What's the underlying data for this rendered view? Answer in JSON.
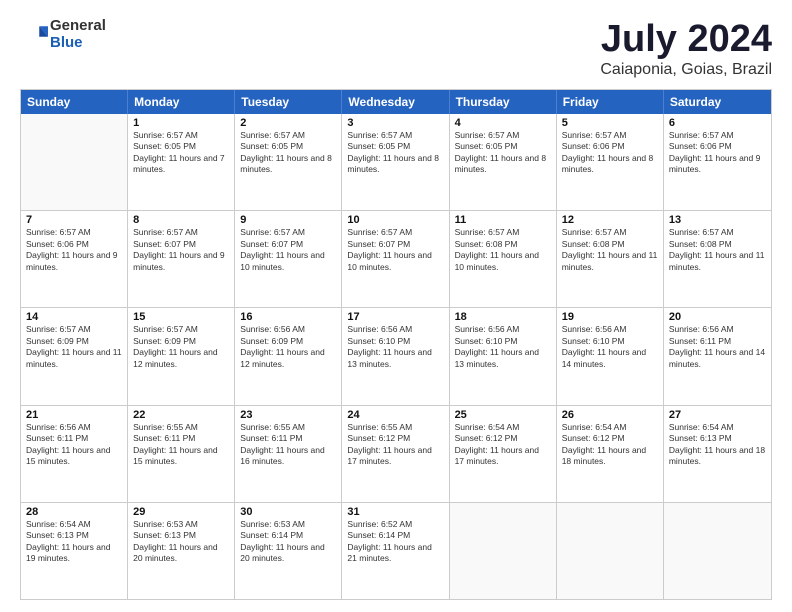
{
  "logo": {
    "general": "General",
    "blue": "Blue"
  },
  "title": "July 2024",
  "subtitle": "Caiaponia, Goias, Brazil",
  "header_days": [
    "Sunday",
    "Monday",
    "Tuesday",
    "Wednesday",
    "Thursday",
    "Friday",
    "Saturday"
  ],
  "weeks": [
    [
      {
        "day": "",
        "sunrise": "",
        "sunset": "",
        "daylight": ""
      },
      {
        "day": "1",
        "sunrise": "Sunrise: 6:57 AM",
        "sunset": "Sunset: 6:05 PM",
        "daylight": "Daylight: 11 hours and 7 minutes."
      },
      {
        "day": "2",
        "sunrise": "Sunrise: 6:57 AM",
        "sunset": "Sunset: 6:05 PM",
        "daylight": "Daylight: 11 hours and 8 minutes."
      },
      {
        "day": "3",
        "sunrise": "Sunrise: 6:57 AM",
        "sunset": "Sunset: 6:05 PM",
        "daylight": "Daylight: 11 hours and 8 minutes."
      },
      {
        "day": "4",
        "sunrise": "Sunrise: 6:57 AM",
        "sunset": "Sunset: 6:05 PM",
        "daylight": "Daylight: 11 hours and 8 minutes."
      },
      {
        "day": "5",
        "sunrise": "Sunrise: 6:57 AM",
        "sunset": "Sunset: 6:06 PM",
        "daylight": "Daylight: 11 hours and 8 minutes."
      },
      {
        "day": "6",
        "sunrise": "Sunrise: 6:57 AM",
        "sunset": "Sunset: 6:06 PM",
        "daylight": "Daylight: 11 hours and 9 minutes."
      }
    ],
    [
      {
        "day": "7",
        "sunrise": "Sunrise: 6:57 AM",
        "sunset": "Sunset: 6:06 PM",
        "daylight": "Daylight: 11 hours and 9 minutes."
      },
      {
        "day": "8",
        "sunrise": "Sunrise: 6:57 AM",
        "sunset": "Sunset: 6:07 PM",
        "daylight": "Daylight: 11 hours and 9 minutes."
      },
      {
        "day": "9",
        "sunrise": "Sunrise: 6:57 AM",
        "sunset": "Sunset: 6:07 PM",
        "daylight": "Daylight: 11 hours and 10 minutes."
      },
      {
        "day": "10",
        "sunrise": "Sunrise: 6:57 AM",
        "sunset": "Sunset: 6:07 PM",
        "daylight": "Daylight: 11 hours and 10 minutes."
      },
      {
        "day": "11",
        "sunrise": "Sunrise: 6:57 AM",
        "sunset": "Sunset: 6:08 PM",
        "daylight": "Daylight: 11 hours and 10 minutes."
      },
      {
        "day": "12",
        "sunrise": "Sunrise: 6:57 AM",
        "sunset": "Sunset: 6:08 PM",
        "daylight": "Daylight: 11 hours and 11 minutes."
      },
      {
        "day": "13",
        "sunrise": "Sunrise: 6:57 AM",
        "sunset": "Sunset: 6:08 PM",
        "daylight": "Daylight: 11 hours and 11 minutes."
      }
    ],
    [
      {
        "day": "14",
        "sunrise": "Sunrise: 6:57 AM",
        "sunset": "Sunset: 6:09 PM",
        "daylight": "Daylight: 11 hours and 11 minutes."
      },
      {
        "day": "15",
        "sunrise": "Sunrise: 6:57 AM",
        "sunset": "Sunset: 6:09 PM",
        "daylight": "Daylight: 11 hours and 12 minutes."
      },
      {
        "day": "16",
        "sunrise": "Sunrise: 6:56 AM",
        "sunset": "Sunset: 6:09 PM",
        "daylight": "Daylight: 11 hours and 12 minutes."
      },
      {
        "day": "17",
        "sunrise": "Sunrise: 6:56 AM",
        "sunset": "Sunset: 6:10 PM",
        "daylight": "Daylight: 11 hours and 13 minutes."
      },
      {
        "day": "18",
        "sunrise": "Sunrise: 6:56 AM",
        "sunset": "Sunset: 6:10 PM",
        "daylight": "Daylight: 11 hours and 13 minutes."
      },
      {
        "day": "19",
        "sunrise": "Sunrise: 6:56 AM",
        "sunset": "Sunset: 6:10 PM",
        "daylight": "Daylight: 11 hours and 14 minutes."
      },
      {
        "day": "20",
        "sunrise": "Sunrise: 6:56 AM",
        "sunset": "Sunset: 6:11 PM",
        "daylight": "Daylight: 11 hours and 14 minutes."
      }
    ],
    [
      {
        "day": "21",
        "sunrise": "Sunrise: 6:56 AM",
        "sunset": "Sunset: 6:11 PM",
        "daylight": "Daylight: 11 hours and 15 minutes."
      },
      {
        "day": "22",
        "sunrise": "Sunrise: 6:55 AM",
        "sunset": "Sunset: 6:11 PM",
        "daylight": "Daylight: 11 hours and 15 minutes."
      },
      {
        "day": "23",
        "sunrise": "Sunrise: 6:55 AM",
        "sunset": "Sunset: 6:11 PM",
        "daylight": "Daylight: 11 hours and 16 minutes."
      },
      {
        "day": "24",
        "sunrise": "Sunrise: 6:55 AM",
        "sunset": "Sunset: 6:12 PM",
        "daylight": "Daylight: 11 hours and 17 minutes."
      },
      {
        "day": "25",
        "sunrise": "Sunrise: 6:54 AM",
        "sunset": "Sunset: 6:12 PM",
        "daylight": "Daylight: 11 hours and 17 minutes."
      },
      {
        "day": "26",
        "sunrise": "Sunrise: 6:54 AM",
        "sunset": "Sunset: 6:12 PM",
        "daylight": "Daylight: 11 hours and 18 minutes."
      },
      {
        "day": "27",
        "sunrise": "Sunrise: 6:54 AM",
        "sunset": "Sunset: 6:13 PM",
        "daylight": "Daylight: 11 hours and 18 minutes."
      }
    ],
    [
      {
        "day": "28",
        "sunrise": "Sunrise: 6:54 AM",
        "sunset": "Sunset: 6:13 PM",
        "daylight": "Daylight: 11 hours and 19 minutes."
      },
      {
        "day": "29",
        "sunrise": "Sunrise: 6:53 AM",
        "sunset": "Sunset: 6:13 PM",
        "daylight": "Daylight: 11 hours and 20 minutes."
      },
      {
        "day": "30",
        "sunrise": "Sunrise: 6:53 AM",
        "sunset": "Sunset: 6:14 PM",
        "daylight": "Daylight: 11 hours and 20 minutes."
      },
      {
        "day": "31",
        "sunrise": "Sunrise: 6:52 AM",
        "sunset": "Sunset: 6:14 PM",
        "daylight": "Daylight: 11 hours and 21 minutes."
      },
      {
        "day": "",
        "sunrise": "",
        "sunset": "",
        "daylight": ""
      },
      {
        "day": "",
        "sunrise": "",
        "sunset": "",
        "daylight": ""
      },
      {
        "day": "",
        "sunrise": "",
        "sunset": "",
        "daylight": ""
      }
    ]
  ]
}
